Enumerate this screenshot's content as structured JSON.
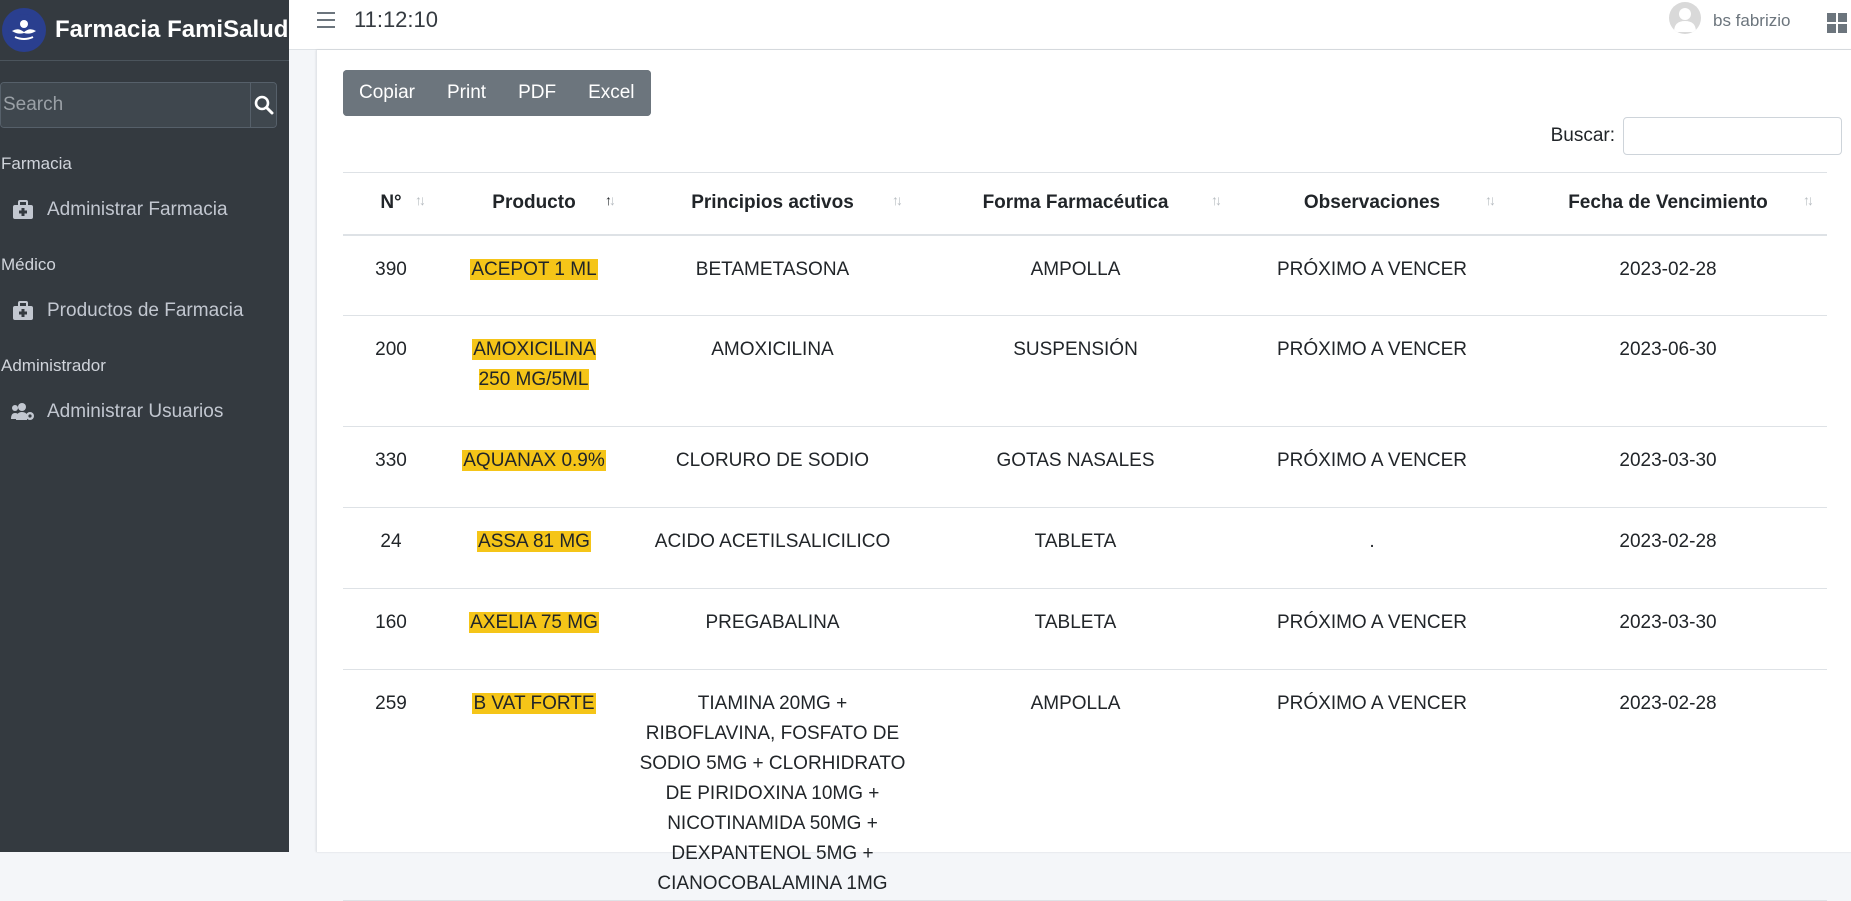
{
  "brand": {
    "name": "Farmacia FamiSalud",
    "logo_icon": "pharmacy-logo-icon"
  },
  "sidebar": {
    "search_placeholder": "Search",
    "sections": [
      {
        "header": "Farmacia",
        "item": "Administrar Farmacia",
        "icon": "medkit-icon"
      },
      {
        "header": "Médico",
        "item": "Productos de Farmacia",
        "icon": "medkit-icon"
      },
      {
        "header": "Administrador",
        "item": "Administrar Usuarios",
        "icon": "users-cog-icon"
      }
    ]
  },
  "topbar": {
    "clock": "11:12:10",
    "user_name": "bs fabrizio"
  },
  "toolbar": {
    "copy": "Copiar",
    "print": "Print",
    "pdf": "PDF",
    "excel": "Excel"
  },
  "filter": {
    "label": "Buscar:"
  },
  "table": {
    "columns": [
      "N°",
      "Producto",
      "Principios activos",
      "Forma Farmacéutica",
      "Observaciones",
      "Fecha de Vencimiento"
    ],
    "sorted_column": "Producto",
    "rows": [
      [
        "390",
        "ACEPOT 1 ML",
        "BETAMETASONA",
        "AMPOLLA",
        "PRÓXIMO A VENCER",
        "2023-02-28"
      ],
      [
        "200",
        "AMOXICILINA 250 MG/5ML",
        "AMOXICILINA",
        "SUSPENSIÓN",
        "PRÓXIMO A VENCER",
        "2023-06-30"
      ],
      [
        "330",
        "AQUANAX 0.9%",
        "CLORURO DE SODIO",
        "GOTAS NASALES",
        "PRÓXIMO A VENCER",
        "2023-03-30"
      ],
      [
        "24",
        "ASSA 81 MG",
        "ACIDO ACETILSALICILICO",
        "TABLETA",
        ".",
        "2023-02-28"
      ],
      [
        "160",
        "AXELIA 75 MG",
        "PREGABALINA",
        "TABLETA",
        "PRÓXIMO A VENCER",
        "2023-03-30"
      ],
      [
        "259",
        "B VAT FORTE",
        "TIAMINA 20MG + RIBOFLAVINA, FOSFATO DE SODIO 5MG + CLORHIDRATO DE PIRIDOXINA 10MG + NICOTINAMIDA 50MG + DEXPANTENOL 5MG + CIANOCOBALAMINA 1MG",
        "AMPOLLA",
        "PRÓXIMO A VENCER",
        "2023-02-28"
      ]
    ]
  },
  "colors": {
    "sidebar_bg": "#343a40",
    "highlight": "#f5c518",
    "button_bg": "#6c757d",
    "brand_logo": "#2a3f8f"
  }
}
